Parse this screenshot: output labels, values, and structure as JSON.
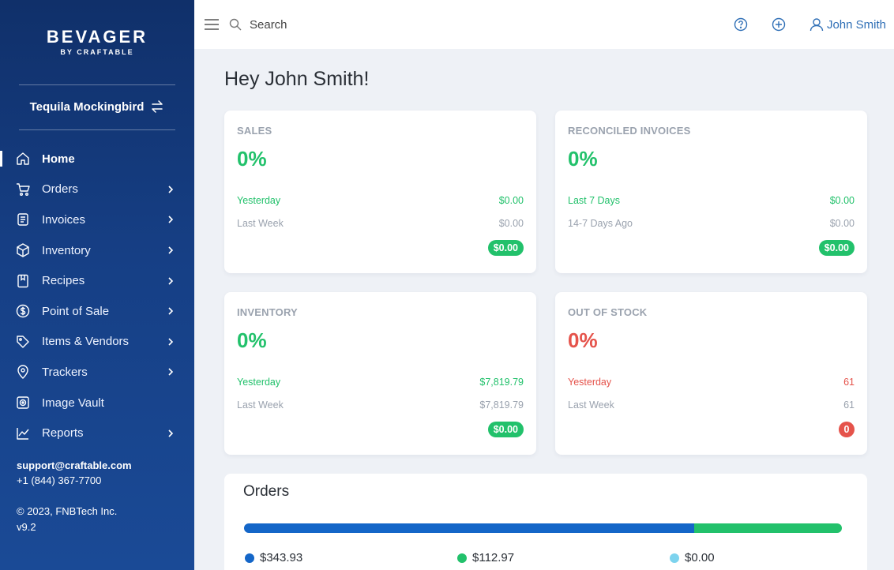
{
  "brand": {
    "name": "BEVAGER",
    "sub": "BY CRAFTABLE"
  },
  "venue": {
    "name": "Tequila Mockingbird"
  },
  "nav": [
    {
      "label": "Home",
      "icon": "home-icon",
      "active": true,
      "chevron": false
    },
    {
      "label": "Orders",
      "icon": "cart-icon",
      "active": false,
      "chevron": true
    },
    {
      "label": "Invoices",
      "icon": "invoice-icon",
      "active": false,
      "chevron": true
    },
    {
      "label": "Inventory",
      "icon": "box-icon",
      "active": false,
      "chevron": true
    },
    {
      "label": "Recipes",
      "icon": "book-icon",
      "active": false,
      "chevron": true
    },
    {
      "label": "Point of Sale",
      "icon": "dollar-icon",
      "active": false,
      "chevron": true
    },
    {
      "label": "Items & Vendors",
      "icon": "tag-icon",
      "active": false,
      "chevron": true
    },
    {
      "label": "Trackers",
      "icon": "location-icon",
      "active": false,
      "chevron": true
    },
    {
      "label": "Image Vault",
      "icon": "image-vault-icon",
      "active": false,
      "chevron": false
    },
    {
      "label": "Reports",
      "icon": "chart-icon",
      "active": false,
      "chevron": true
    }
  ],
  "support": {
    "email": "support@craftable.com",
    "phone": "+1 (844) 367-7700"
  },
  "footer": {
    "copyright": "© 2023, FNBTech Inc.",
    "version": "v9.2"
  },
  "topbar": {
    "search_placeholder": "Search",
    "user_name": "John Smith"
  },
  "greeting": "Hey John Smith!",
  "cards": {
    "sales": {
      "title": "SALES",
      "pct": "0%",
      "row1_label": "Yesterday",
      "row1_value": "$0.00",
      "row2_label": "Last Week",
      "row2_value": "$0.00",
      "pill": "$0.00"
    },
    "reconciled": {
      "title": "RECONCILED INVOICES",
      "pct": "0%",
      "row1_label": "Last 7 Days",
      "row1_value": "$0.00",
      "row2_label": "14-7 Days Ago",
      "row2_value": "$0.00",
      "pill": "$0.00"
    },
    "inventory": {
      "title": "INVENTORY",
      "pct": "0%",
      "row1_label": "Yesterday",
      "row1_value": "$7,819.79",
      "row2_label": "Last Week",
      "row2_value": "$7,819.79",
      "pill": "$0.00"
    },
    "outofstock": {
      "title": "OUT OF STOCK",
      "pct": "0%",
      "row1_label": "Yesterday",
      "row1_value": "61",
      "row2_label": "Last Week",
      "row2_value": "61",
      "pill": "0"
    }
  },
  "orders": {
    "title": "Orders",
    "segments": [
      {
        "value": 343.93,
        "label": "$343.93",
        "color": "#1466c8"
      },
      {
        "value": 112.97,
        "label": "$112.97",
        "color": "#22c16b"
      },
      {
        "value": 0.0,
        "label": "$0.00",
        "color": "#7dd3ee"
      }
    ]
  },
  "colors": {
    "accent": "#2f6fb6",
    "green": "#22c16b",
    "red": "#e5534b",
    "sidebar": "#163f85"
  }
}
